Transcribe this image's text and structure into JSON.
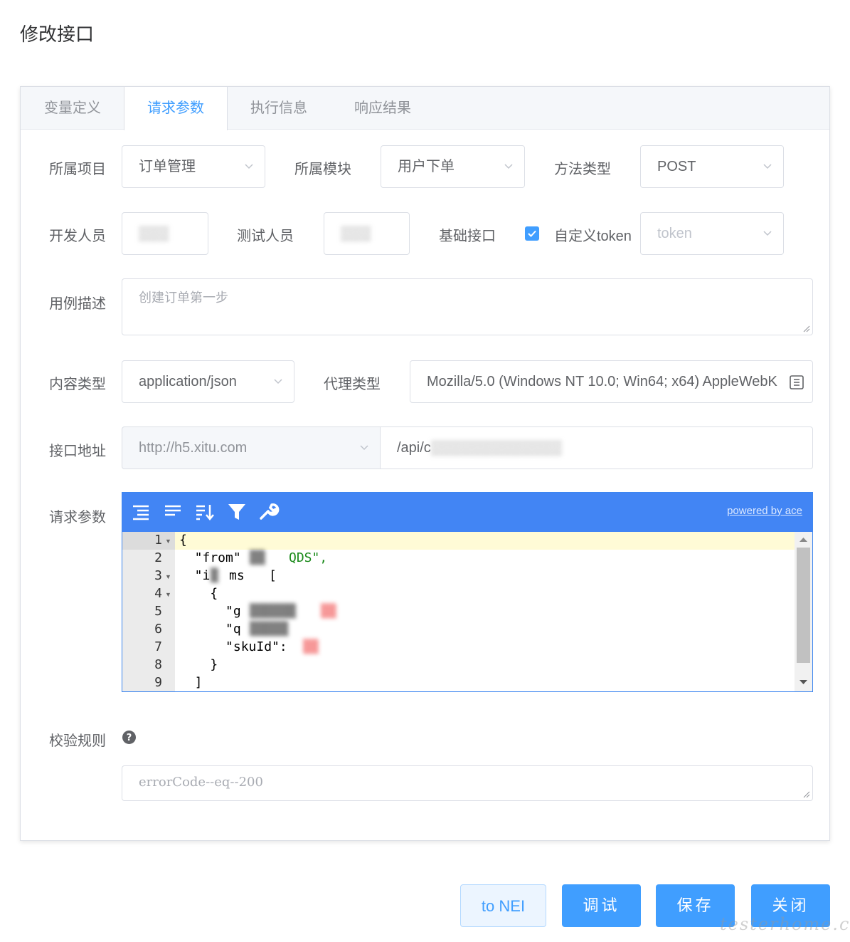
{
  "dialog": {
    "title": "修改接口"
  },
  "tabs": [
    {
      "label": "变量定义",
      "active": false
    },
    {
      "label": "请求参数",
      "active": true
    },
    {
      "label": "执行信息",
      "active": false
    },
    {
      "label": "响应结果",
      "active": false
    }
  ],
  "form": {
    "project": {
      "label": "所属项目",
      "value": "订单管理"
    },
    "module": {
      "label": "所属模块",
      "value": "用户下单"
    },
    "method": {
      "label": "方法类型",
      "value": "POST"
    },
    "developer": {
      "label": "开发人员",
      "value": ""
    },
    "tester": {
      "label": "测试人员",
      "value": ""
    },
    "base_interface": {
      "label": "基础接口"
    },
    "custom_token": {
      "label": "自定义token",
      "checked": true
    },
    "token_select": {
      "placeholder": "token"
    },
    "description": {
      "label": "用例描述",
      "placeholder": "创建订单第一步"
    },
    "content_type": {
      "label": "内容类型",
      "value": "application/json"
    },
    "proxy_type": {
      "label": "代理类型",
      "value": "Mozilla/5.0 (Windows NT 10.0; Win64; x64) AppleWebK"
    },
    "address": {
      "label": "接口地址",
      "host": "http://h5.xitu.com",
      "path": "/api/c"
    },
    "request_params": {
      "label": "请求参数"
    },
    "validation": {
      "label": "校验规则",
      "placeholder": "errorCode--eq--200"
    }
  },
  "editor": {
    "powered_by": "powered by ace",
    "tools": [
      "format-icon",
      "compact-icon",
      "sort-icon",
      "filter-icon",
      "wrench-icon"
    ],
    "lines": [
      {
        "no": "1",
        "text": "{"
      },
      {
        "no": "2",
        "text": "  \"from\""
      },
      {
        "no": "3",
        "text": "  \"i"
      },
      {
        "no": "4",
        "text": "    {"
      },
      {
        "no": "5",
        "text": "      \"g"
      },
      {
        "no": "6",
        "text": "      \"q"
      },
      {
        "no": "7",
        "text": "      \"skuId\":"
      },
      {
        "no": "8",
        "text": "    }"
      },
      {
        "no": "9",
        "text": "  ]"
      }
    ],
    "fragments": {
      "l2_end": "QDS\",",
      "l3_mid": "ms",
      "l3_end": "[",
      "l5_val": "g"
    }
  },
  "buttons": {
    "to_nei": "to NEI",
    "debug": "调试",
    "save": "保存",
    "close": "关闭"
  },
  "watermark": "testerhome.com",
  "colors": {
    "primary": "#409eff",
    "editor_bar": "#4285f4"
  }
}
